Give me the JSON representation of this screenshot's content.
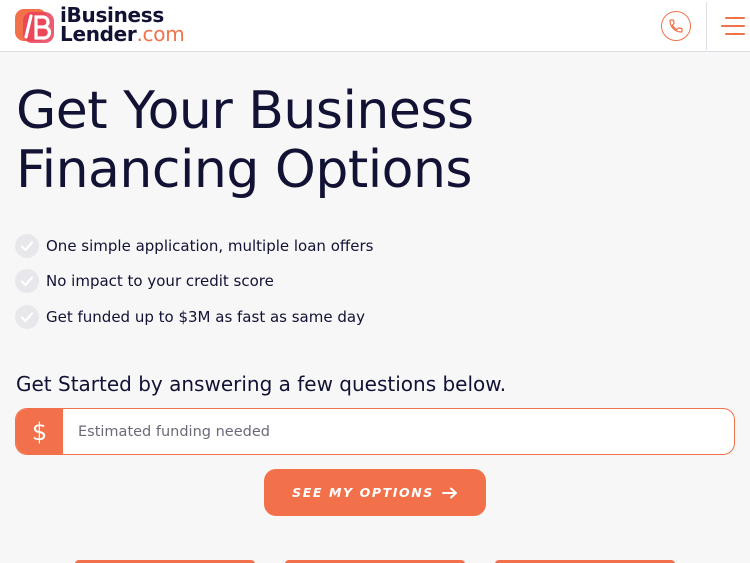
{
  "header": {
    "brand_line1": "iBusiness",
    "brand_line2": "Lender",
    "brand_suffix": ".com",
    "logo_icon": "ibl-logo-icon",
    "phone_icon": "phone-icon",
    "menu_icon": "hamburger-menu-icon"
  },
  "hero": {
    "title_line1": "Get Your Business",
    "title_line2": "Financing Options"
  },
  "benefits": [
    "One simple application, multiple loan offers",
    "No impact to your credit score",
    "Get funded up to $3M as fast as same day"
  ],
  "form": {
    "prompt": "Get Started by answering a few questions below.",
    "currency_symbol": "$",
    "funding_placeholder": "Estimated funding needed",
    "funding_value": "",
    "cta_label": "SEE MY OPTIONS",
    "cta_icon": "arrow-right-icon"
  },
  "colors": {
    "accent": "#f3714a",
    "text": "#121235",
    "background": "#f7f7f8",
    "check_bg": "#e8e8ec"
  }
}
